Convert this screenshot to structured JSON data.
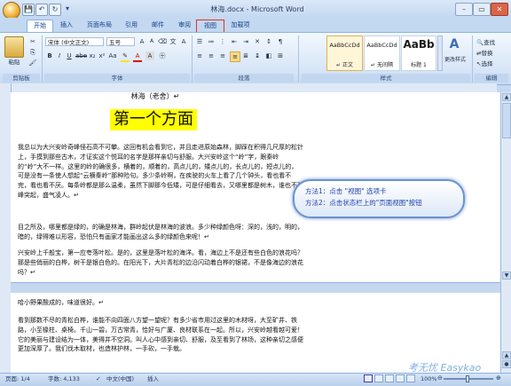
{
  "window": {
    "title": "林海.docx - Microsoft Word"
  },
  "quick_access": {
    "save": "💾",
    "undo": "↶",
    "redo": "↻",
    "more": "▾"
  },
  "window_controls": {
    "minimize": "–",
    "maximize": "▭",
    "close": "✕"
  },
  "tabs": [
    "开始",
    "插入",
    "页面布局",
    "引用",
    "邮件",
    "审阅",
    "视图",
    "加载项"
  ],
  "ribbon": {
    "paste_label": "粘贴",
    "font_name": "宋体 (中文正文)",
    "font_size": "五号",
    "group_clipboard": "剪贴板",
    "group_font": "字体",
    "group_paragraph": "段落",
    "group_styles": "样式",
    "group_edit": "编辑",
    "styles": [
      {
        "sample": "AaBbCcDd",
        "name": "↵ 正文"
      },
      {
        "sample": "AaBbCcDd",
        "name": "↵ 无间隔"
      },
      {
        "sample": "AaBb",
        "name": "标题 1"
      }
    ],
    "change_styles": "更改样式",
    "find": "查找",
    "replace": "替换",
    "select": "选择"
  },
  "document": {
    "heading": "林海（老舍）↵",
    "chapter": "第一个方面",
    "p1": "我总以为大兴安岭奇峰怪石高不可攀。这回有机会看到它，并且走进原始森林，脚踩在积得几尺厚的松针上，手摸到那些古木，才证实这个悦耳的名字是那样亲切与舒服。大兴安岭这个“岭”字，跟秦岭的“岭”大不一样。这里的岭的确很多，横着的，顺着的，高点儿的，矮点儿的，长点儿的，短点儿的，可是没有一条使人想起“云横秦岭”那种险句。多少条岭啊，在疾驶的火车上看了几个钟头，看也看不完，看也看不厌。每条岭都是那么温柔，虽然下脚那今低矮，可是仔细看去，又哪里都是树木，谁也不孤峰突起，盛气凌人。↵",
    "p2": "目之所及，哪里都是绿的，的确是林海，群岭起伏是林海的波浪。多少种绿颜色呀：深的，浅的，明的，暗的，绿得难以形容，恐怕只有画家才能画出这么多的绿颜色来呢！↵",
    "p3": "兴安岭上千般宝，第一应夸落叶松。是的，这里是落叶松的海洋。看，海边上不是还有些白色的浪花吗？那是些俏丽的白桦，树干是银白色的。在阳光下，大片青松的边沿闪动着白桦的银裙，不是像海边的浪花吗？↵",
    "p4": "哈小野果酸成的，味道很好。↵",
    "p5": "看到那数不尽的青松白桦，谁能不向四面八方望一望呢？有多少省市用过这里的木材呀，大至矿井、铁路，小至椽柱、桌椅。千山一碧，万古常青，恰好与广厦、良材联系在一起。所以，兴安岭越看越可爱！它的美丽与建设结为一体，美得并不空洞。叫人心中感到亲切、舒服，及至看到了林场，这种亲切之感便更加深厚了。我们伐木取材，也造林护林，一手砍，一手栽。"
  },
  "callout": {
    "line1": "方法1：点击 \"视图\" 选项卡",
    "line2": "方法2：点击状态栏上的\"页面视图\"按钮"
  },
  "status": {
    "page": "页面: 1/4",
    "words": "字数: 4,133",
    "lang": "中文(中国)",
    "mode": "插入",
    "zoom": "100%"
  },
  "watermark": "考无忧 Easykao"
}
